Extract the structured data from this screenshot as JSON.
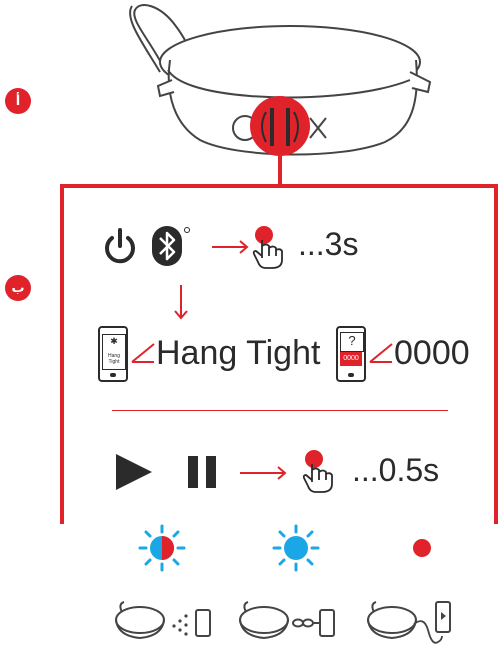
{
  "markers": {
    "a": "أ",
    "b": "ب"
  },
  "pairing": {
    "hold_time": "...3s",
    "status_text": "Hang Tight",
    "phone_screen_text": "Hang Tight",
    "pin_code": "0000",
    "pin_phone_question": "?",
    "pin_phone_code": "0000"
  },
  "playback": {
    "hold_time": "...0.5s"
  },
  "led_states": [
    {
      "name": "blinking-blue-red",
      "colors": [
        "#1ba6e6",
        "#e0222b"
      ]
    },
    {
      "name": "solid-blue",
      "colors": [
        "#1ba6e6"
      ]
    },
    {
      "name": "solid-red",
      "colors": [
        "#e0222b"
      ]
    }
  ],
  "connection_states": [
    "wireless-pairing",
    "connected",
    "charging"
  ],
  "colors": {
    "accent": "#e0222b",
    "led_blue": "#1ba6e6",
    "ink": "#2b2b2b"
  }
}
